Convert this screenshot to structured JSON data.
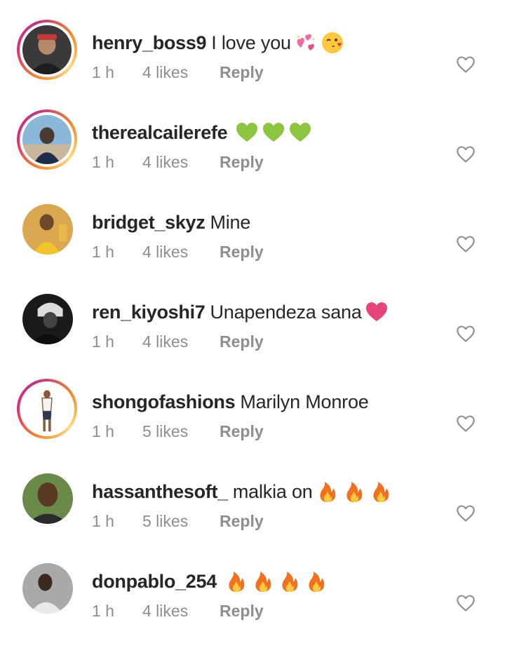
{
  "comments": [
    {
      "username": "henry_boss9",
      "text": "I love you",
      "emojis": [
        "sparkling-hearts-emoji",
        "kissing-face-emoji"
      ],
      "time": "1 h",
      "likes": "4 likes",
      "reply": "Reply",
      "story_ring": true,
      "avatar_colors": [
        "#2a2a2a",
        "#c23a3a",
        "#e8d4c0"
      ]
    },
    {
      "username": "therealcailerefe",
      "text": "",
      "emojis": [
        "green-heart-emoji",
        "green-heart-emoji",
        "green-heart-emoji"
      ],
      "time": "1 h",
      "likes": "4 likes",
      "reply": "Reply",
      "story_ring": true,
      "avatar_colors": [
        "#8bb7d9",
        "#1e2b4a",
        "#4a3a30"
      ]
    },
    {
      "username": "bridget_skyz",
      "text": "Mine",
      "emojis": [],
      "time": "1 h",
      "likes": "4 likes",
      "reply": "Reply",
      "story_ring": false,
      "avatar_colors": [
        "#d9a850",
        "#f2c42c",
        "#6b4a2a"
      ]
    },
    {
      "username": "ren_kiyoshi7",
      "text": "Unapendeza sana",
      "emojis": [
        "pink-heart-emoji"
      ],
      "time": "1 h",
      "likes": "4 likes",
      "reply": "Reply",
      "story_ring": false,
      "avatar_colors": [
        "#111111",
        "#444444",
        "#dcdcdc"
      ]
    },
    {
      "username": "shongofashions",
      "text": "Marilyn Monroe",
      "emojis": [],
      "time": "1 h",
      "likes": "5 likes",
      "reply": "Reply",
      "story_ring": true,
      "avatar_colors": [
        "#ffffff",
        "#8a5a3c",
        "#2f3b55"
      ]
    },
    {
      "username": "hassanthesoft_",
      "text": "malkia on",
      "emojis": [
        "fire-emoji",
        "fire-emoji",
        "fire-emoji"
      ],
      "time": "1 h",
      "likes": "5 likes",
      "reply": "Reply",
      "story_ring": false,
      "avatar_colors": [
        "#6a8a4a",
        "#5a3a22",
        "#2a2a2a"
      ]
    },
    {
      "username": "donpablo_254",
      "text": "",
      "emojis": [
        "fire-emoji",
        "fire-emoji",
        "fire-emoji",
        "fire-emoji"
      ],
      "time": "1 h",
      "likes": "4 likes",
      "reply": "Reply",
      "story_ring": false,
      "avatar_colors": [
        "#a9a9a9",
        "#3a2a20",
        "#e9e9e9"
      ]
    }
  ],
  "colors": {
    "username": "#262626",
    "meta": "#8e8e8e",
    "like_icon": "#8e8e8e",
    "story_ring_start": "#f58529",
    "story_ring_end": "#dd2a7b"
  }
}
